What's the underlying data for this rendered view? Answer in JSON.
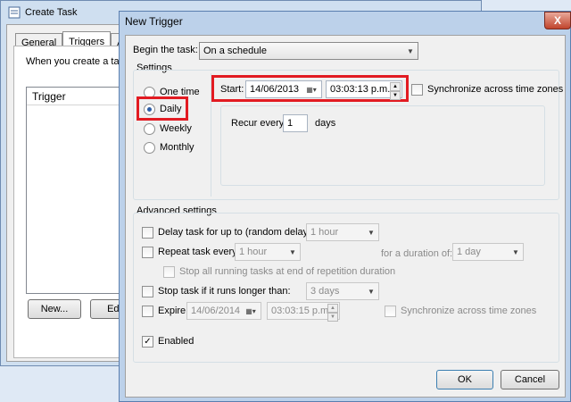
{
  "bg_window": {
    "title": "Create Task",
    "tabs": [
      "General",
      "Triggers",
      "Actio"
    ],
    "active_tab": "Triggers",
    "hint_text": "When you create a task,",
    "trigger_column": "Trigger",
    "new_button": "New...",
    "edit_button": "Edi"
  },
  "dialog": {
    "title": "New Trigger",
    "close_glyph": "X",
    "begin_label": "Begin the task:",
    "begin_value": "On a schedule",
    "settings_label": "Settings",
    "schedule_options": [
      "One time",
      "Daily",
      "Weekly",
      "Monthly"
    ],
    "selected_option": "Daily",
    "start_label": "Start:",
    "start_date": "14/06/2013",
    "start_time": "03:03:13 p.m.",
    "sync_label": "Synchronize across time zones",
    "recur_label": "Recur every:",
    "recur_value": "1",
    "recur_unit": "days",
    "advanced_label": "Advanced settings",
    "delay_label": "Delay task for up to (random delay):",
    "delay_value": "1 hour",
    "repeat_label": "Repeat task every:",
    "repeat_value": "1 hour",
    "duration_label": "for a duration of:",
    "duration_value": "1 day",
    "stop_running_label": "Stop all running tasks at end of repetition duration",
    "stop_if_label": "Stop task if it runs longer than:",
    "stop_if_value": "3 days",
    "expire_label": "Expire:",
    "expire_date": "14/06/2014",
    "expire_time": "03:03:15 p.m.",
    "expire_sync_label": "Synchronize across time zones",
    "enabled_label": "Enabled",
    "ok_button": "OK",
    "cancel_button": "Cancel"
  },
  "colors": {
    "highlight": "#e21b22",
    "title_bar": "#bcd1ea"
  }
}
